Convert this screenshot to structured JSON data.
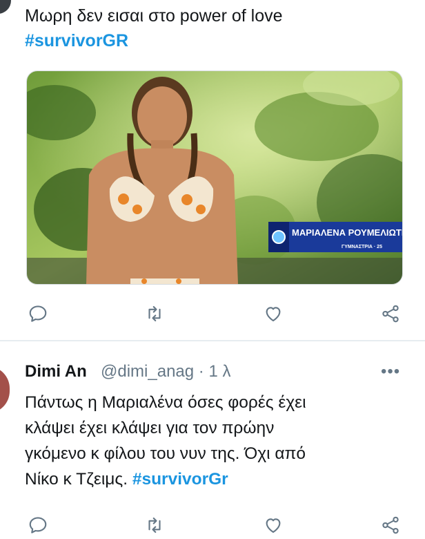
{
  "tweet1": {
    "text": "Μωρη δεν εισαι στο power of love",
    "hashtag": "#survivorGR",
    "media": {
      "caption_name": "ΜΑΡΙΑΛΕΝΑ ΡΟΥΜΕΛΙΩΤΗ",
      "caption_sub": "ΓΥΜΝΑΣΤΡΙΑ · 25"
    }
  },
  "tweet2": {
    "name": "Dimi An",
    "handle": "@dimi_anag",
    "meta": "· 1 λ",
    "more": "•••",
    "text": "Πάντως η Μαριαλένα όσες φορές έχει\nκλάψει έχει κλάψει για τον πρώην\nγκόμενο κ φίλου του νυν της. Όχι από\nΝίκο κ Τζειμς.",
    "hashtag": "#survivorGr"
  },
  "icons": [
    "reply-icon",
    "retweet-icon",
    "like-icon",
    "share-icon"
  ],
  "colors": {
    "hashtag": "#1b95e0",
    "icon": "#657786",
    "caption_bar": "#1a3a9a"
  }
}
